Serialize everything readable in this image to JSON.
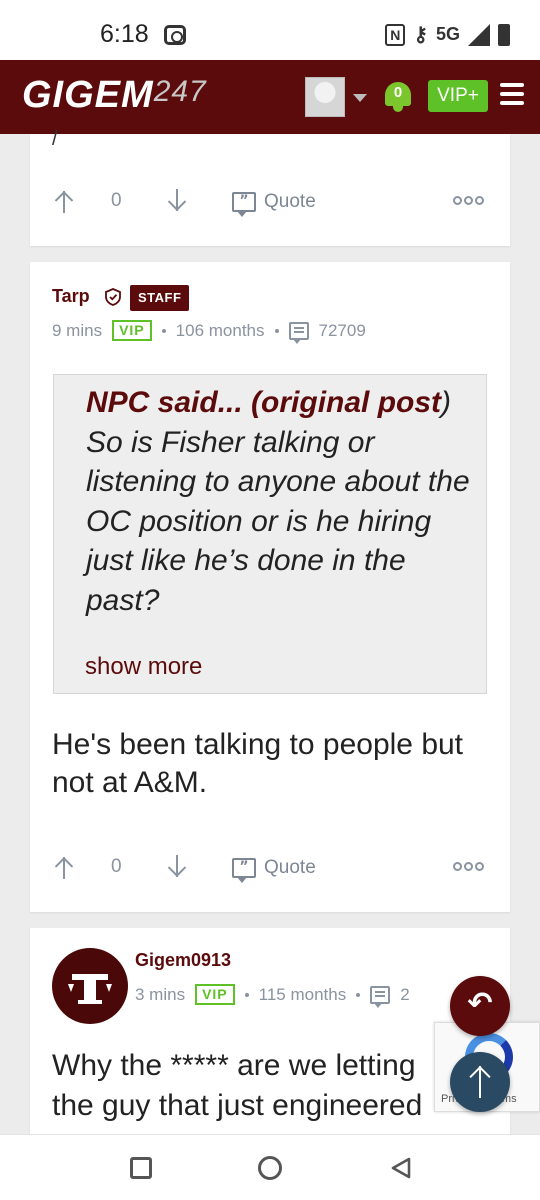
{
  "status_bar": {
    "time": "6:18",
    "nfc": "N",
    "network": "5G"
  },
  "header": {
    "logo_main": "GIGEM",
    "logo_num": "247",
    "notification_count": "0",
    "vip_label": "VIP+"
  },
  "posts": [
    {
      "tail_text": "/",
      "vote_count": "0",
      "quote_label": "Quote"
    },
    {
      "author": "Tarp",
      "badge": "STAFF",
      "time_ago": "9 mins",
      "vip_tag": "VIP",
      "tenure": "106 months",
      "post_count": "72709",
      "quote": {
        "author_prefix": "NPC said... (original post",
        "author_suffix": ")",
        "text": " So is Fisher talking or listening to anyone about the OC position or is he hiring just like he’s done in the past?",
        "show_more": "show more"
      },
      "body": "He's been talking to people but not at A&M.",
      "vote_count": "0",
      "quote_label": "Quote"
    },
    {
      "author": "Gigem0913",
      "avatar_letters": "A M",
      "time_ago": "3 mins",
      "vip_tag": "VIP",
      "tenure": "115 months",
      "post_count": "2",
      "body_line1": "Why the ***** are we letting",
      "body_line2": "the guy that just engineered"
    }
  ],
  "recaptcha": {
    "text": "Privacy - Terms"
  },
  "colors": {
    "maroon": "#5b0b0b",
    "vip_green": "#5ec127",
    "muted_gray": "#8a93a0",
    "scroll_top_blue": "#294a62"
  },
  "icons": {
    "upvote": "arrow-up-icon",
    "downvote": "arrow-down-icon",
    "quote": "quote-icon",
    "more": "more-icon",
    "posts": "posts-icon",
    "notifications": "bell-icon",
    "menu": "menu-icon",
    "reply": "reply-icon",
    "scroll_top": "arrow-up-icon"
  }
}
